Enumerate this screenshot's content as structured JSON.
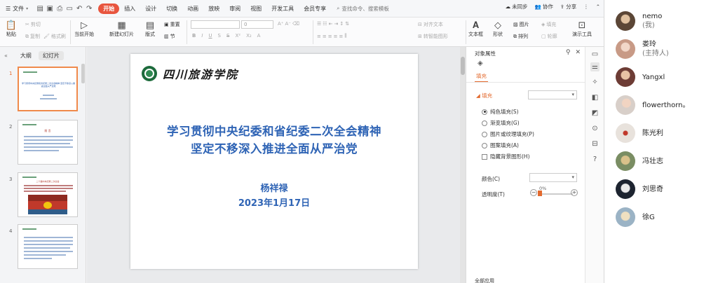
{
  "menubar": {
    "file_label": "文件",
    "tabs": [
      {
        "label": "开始",
        "active": true
      },
      {
        "label": "插入",
        "active": false
      },
      {
        "label": "设计",
        "active": false
      },
      {
        "label": "切换",
        "active": false
      },
      {
        "label": "动画",
        "active": false
      },
      {
        "label": "放映",
        "active": false
      },
      {
        "label": "审阅",
        "active": false
      },
      {
        "label": "视图",
        "active": false
      },
      {
        "label": "开发工具",
        "active": false
      },
      {
        "label": "会员专享",
        "active": false
      }
    ],
    "search_placeholder": "查找命令、搜索模板",
    "sync_label": "未同步",
    "collab_label": "协作",
    "share_label": "分享"
  },
  "ribbon": {
    "paste": "粘贴",
    "cut": "剪切",
    "copy": "复制",
    "format_painter": "格式刷",
    "play_from_current": "当前开始",
    "new_slide": "新建幻灯片",
    "layout": "版式",
    "reset": "重置",
    "section": "节",
    "font_size": "0",
    "align_text": "对齐文本",
    "convert_smartart": "转智能图形",
    "textbox": "文本框",
    "shape": "形状",
    "arrange": "排列",
    "picture": "图片",
    "fill": "填充",
    "outline": "轮廓",
    "presentation_tools": "演示工具"
  },
  "leftpanel": {
    "tab_outline": "大纲",
    "tab_slides": "幻灯片",
    "thumbnails": [
      {
        "num": "1",
        "title": "学习贯彻中央纪委和省纪委二次全会精神 坚定不移深入推进全面从严治党"
      },
      {
        "num": "2",
        "title": "前 言"
      },
      {
        "num": "3",
        "title": "二十届中央纪委二次全会"
      },
      {
        "num": "4",
        "title": ""
      }
    ]
  },
  "slide": {
    "logo_text": "四川旅游学院",
    "title_line1": "学习贯彻中央纪委和省纪委二次全会精神",
    "title_line2": "坚定不移深入推进全面从严治党",
    "presenter": "杨祥禄",
    "date": "2023年1月17日",
    "title_color": "#2f64b5"
  },
  "props": {
    "panel_title": "对象属性",
    "fill_tab": "填充",
    "fill_section": "填充",
    "options": [
      {
        "label": "纯色填充(S)",
        "selected": true,
        "kind": "radio"
      },
      {
        "label": "渐变填充(G)",
        "selected": false,
        "kind": "radio"
      },
      {
        "label": "图片或纹理填充(P)",
        "selected": false,
        "kind": "radio"
      },
      {
        "label": "图案填充(A)",
        "selected": false,
        "kind": "radio"
      },
      {
        "label": "隐藏背景图形(H)",
        "selected": false,
        "kind": "checkbox"
      }
    ],
    "color_label": "颜色(C)",
    "transparency_label": "透明度(T)",
    "transparency_value": "0%",
    "bottom_label": "全部应用",
    "accent": "#e36a2e"
  },
  "participants": [
    {
      "name": "nemo",
      "sub": "(我)",
      "avatar_color": "#5b4636"
    },
    {
      "name": "娄玲",
      "sub": "(主持人)",
      "avatar_color": "#c89a86"
    },
    {
      "name": "Yangxl",
      "sub": "",
      "avatar_color": "#6d3c35"
    },
    {
      "name": "flowerthorn。",
      "sub": "",
      "avatar_color": "#d8cfc9"
    },
    {
      "name": "陈光利",
      "sub": "",
      "avatar_color": "#e8e2dc"
    },
    {
      "name": "冯壮志",
      "sub": "",
      "avatar_color": "#7a8d63"
    },
    {
      "name": "刘思奇",
      "sub": "",
      "avatar_color": "#1d2430"
    },
    {
      "name": "徐G",
      "sub": "",
      "avatar_color": "#9bb3c5"
    }
  ]
}
